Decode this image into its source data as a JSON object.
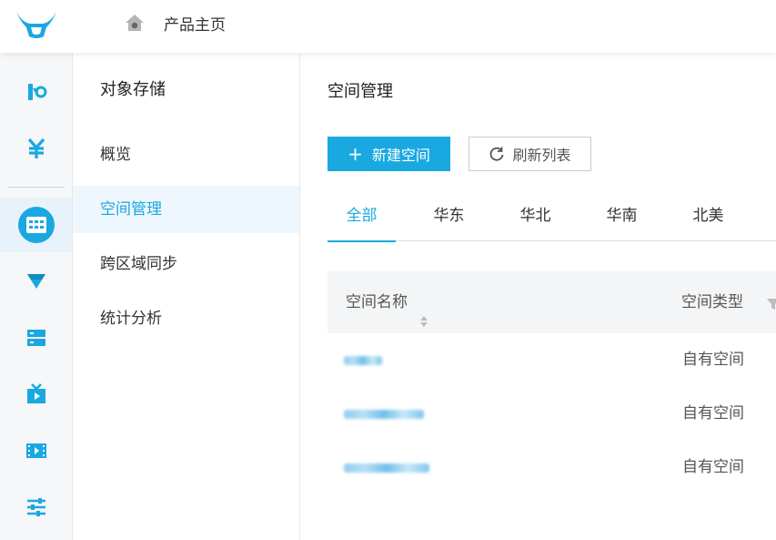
{
  "header": {
    "home_label": "产品主页",
    "logo_icon": "bull-logo-icon",
    "home_icon": "home-icon"
  },
  "rail": {
    "items": [
      {
        "name": "rail-item-kodo",
        "icon": "kodo-icon"
      },
      {
        "name": "rail-item-billing",
        "icon": "yen-icon"
      },
      {
        "name": "rail-item-storage",
        "icon": "storage-grid-icon",
        "active": true
      },
      {
        "name": "rail-item-cdn",
        "icon": "cdn-icon"
      },
      {
        "name": "rail-item-server",
        "icon": "server-icon"
      },
      {
        "name": "rail-item-live",
        "icon": "tv-icon"
      },
      {
        "name": "rail-item-video",
        "icon": "film-icon"
      },
      {
        "name": "rail-item-settings",
        "icon": "sliders-icon"
      }
    ]
  },
  "subnav": {
    "title": "对象存储",
    "items": [
      {
        "label": "概览"
      },
      {
        "label": "空间管理",
        "active": true
      },
      {
        "label": "跨区域同步"
      },
      {
        "label": "统计分析"
      }
    ]
  },
  "main": {
    "title": "空间管理",
    "new_button": "新建空间",
    "refresh_button": "刷新列表",
    "tabs": [
      {
        "label": "全部",
        "active": true
      },
      {
        "label": "华东"
      },
      {
        "label": "华北"
      },
      {
        "label": "华南"
      },
      {
        "label": "北美"
      }
    ],
    "table": {
      "columns": [
        "空间名称",
        "空间类型"
      ],
      "rows": [
        {
          "type": "自有空间"
        },
        {
          "type": "自有空间"
        },
        {
          "type": "自有空间"
        }
      ]
    }
  },
  "colors": {
    "accent": "#1aa8e0",
    "rail_bg": "#f5f7f9",
    "active_bg": "#eef7fd"
  }
}
